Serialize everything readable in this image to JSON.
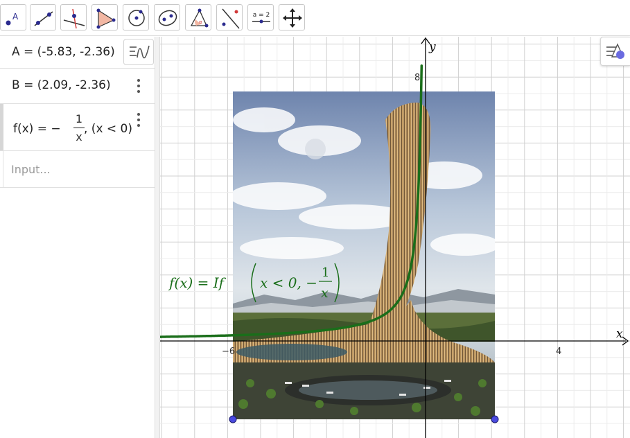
{
  "toolbar": {
    "tools": [
      {
        "icon": "point-tool-icon",
        "label": "A"
      },
      {
        "icon": "line-tool-icon"
      },
      {
        "icon": "perpendicular-tool-icon"
      },
      {
        "icon": "polygon-tool-icon"
      },
      {
        "icon": "circle-center-tool-icon"
      },
      {
        "icon": "conic-tool-icon"
      },
      {
        "icon": "angle-tool-icon"
      },
      {
        "icon": "reflect-tool-icon"
      },
      {
        "icon": "slider-tool-icon",
        "label": "a = 2"
      },
      {
        "icon": "move-graphics-view-icon"
      }
    ]
  },
  "algebra": {
    "items": [
      {
        "text": "A = (-5.83, -2.36)"
      },
      {
        "text": "B = (2.09, -2.36)"
      },
      {
        "fx_prefix": "f(x) = −",
        "numerator": "1",
        "denominator": "x",
        "condition": ",    (x < 0)"
      }
    ],
    "input_placeholder": "Input..."
  },
  "graphics": {
    "axis_x_label": "x",
    "axis_y_label": "y",
    "tick_labels": {
      "x_neg6": "−6",
      "x_4": "4",
      "y_8": "8"
    },
    "function_label": {
      "prefix": "f(x)  =  If",
      "condition": "x < 0, −",
      "numerator": "1",
      "denominator": "x"
    },
    "colors": {
      "function": "#1a6e1a",
      "points": "#4a4adf",
      "grid_minor": "#ececec",
      "grid_major": "#d0d0d0",
      "axis": "#000000",
      "marker_a": "#4a4adf",
      "marker_f": "#1a6e1a"
    },
    "image_description_icon": "futuristic-tower-photo"
  }
}
